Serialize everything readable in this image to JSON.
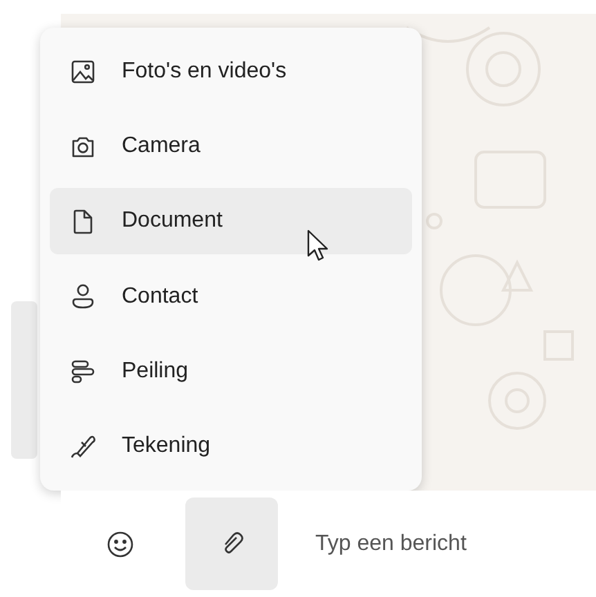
{
  "attach_menu": {
    "items": [
      {
        "label": "Foto's en video's",
        "selected": false
      },
      {
        "label": "Camera",
        "selected": false
      },
      {
        "label": "Document",
        "selected": true
      },
      {
        "label": "Contact",
        "selected": false
      },
      {
        "label": "Peiling",
        "selected": false
      },
      {
        "label": "Tekening",
        "selected": false
      }
    ]
  },
  "composer": {
    "attach_pressed": true,
    "placeholder": "Typ een bericht"
  }
}
